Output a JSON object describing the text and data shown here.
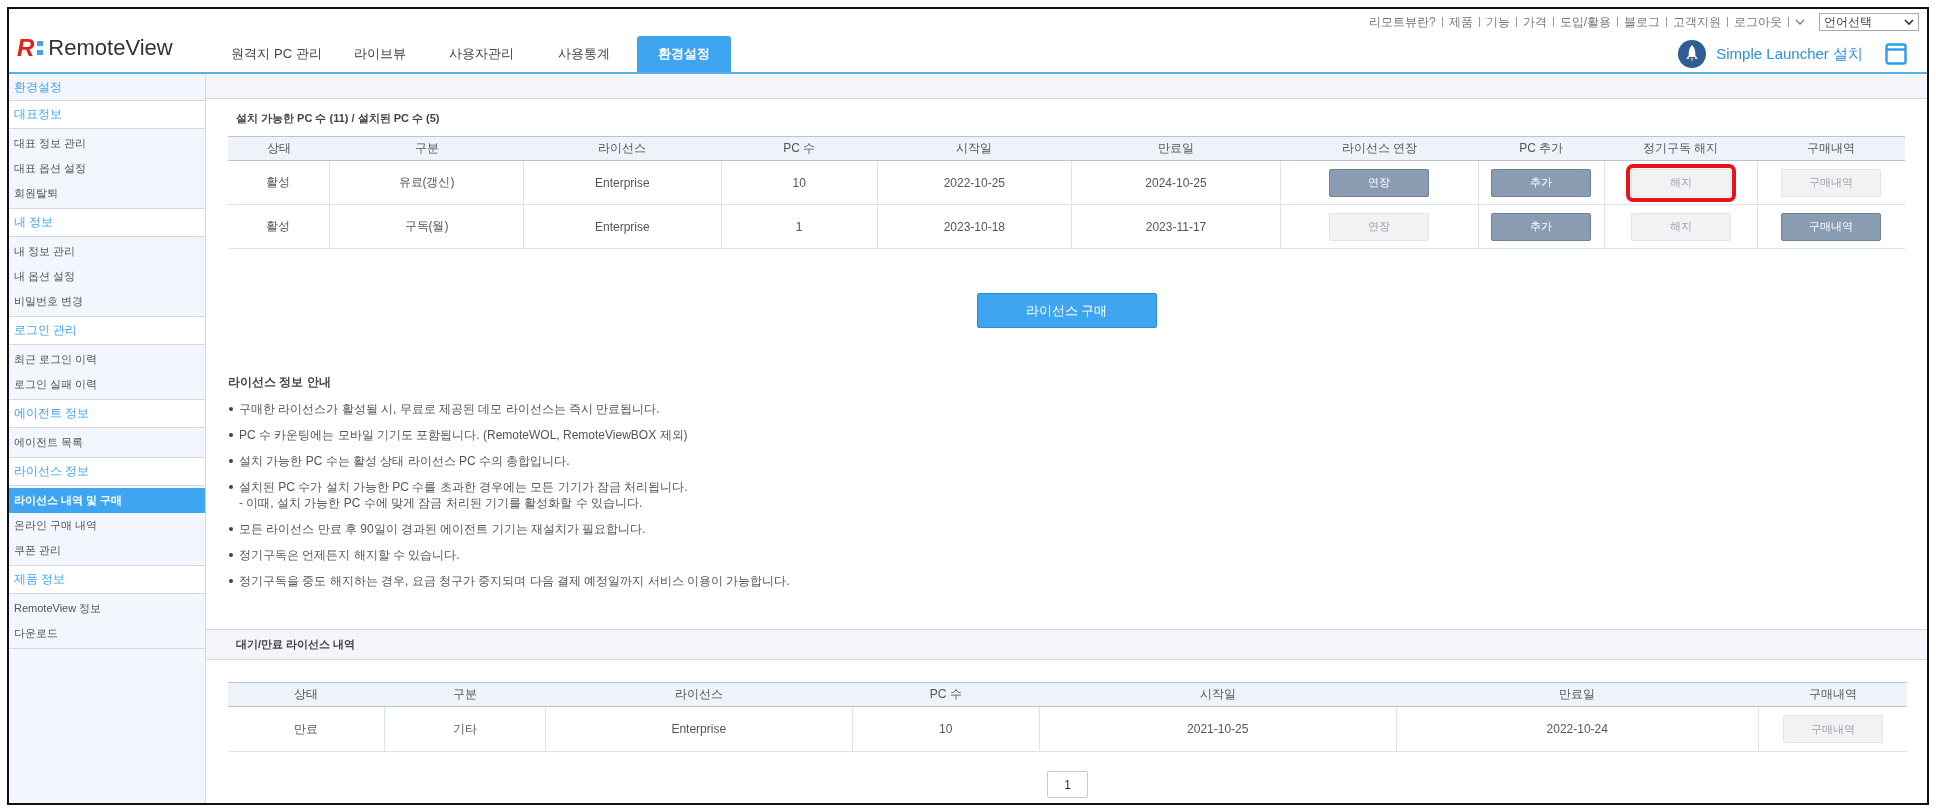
{
  "logo": {
    "letter": "R",
    "name": "RemoteView"
  },
  "tabs": [
    {
      "label": "원격지 PC 관리",
      "selected": false
    },
    {
      "label": "라이브뷰",
      "selected": false
    },
    {
      "label": "사용자관리",
      "selected": false
    },
    {
      "label": "사용통계",
      "selected": false
    },
    {
      "label": "환경설정",
      "selected": true
    }
  ],
  "top_links": [
    "리모트뷰란?",
    "제품",
    "기능",
    "가격",
    "도입/활용",
    "블로그",
    "고객지원",
    "로그아웃"
  ],
  "language_select": {
    "value": "언어선택"
  },
  "launcher_link": "Simple Launcher 설치",
  "sidebar": {
    "title": "환경설정",
    "sections": [
      {
        "title": "대표정보",
        "items": [
          {
            "label": "대표 정보 관리",
            "selected": false
          },
          {
            "label": "대표 옵션 설정",
            "selected": false
          },
          {
            "label": "회원탈퇴",
            "selected": false
          }
        ]
      },
      {
        "title": "내 정보",
        "items": [
          {
            "label": "내 정보 관리",
            "selected": false
          },
          {
            "label": "내 옵션 설정",
            "selected": false
          },
          {
            "label": "비밀번호 변경",
            "selected": false
          }
        ]
      },
      {
        "title": "로그인 관리",
        "items": [
          {
            "label": "최근 로그인 이력",
            "selected": false
          },
          {
            "label": "로그인 실패 이력",
            "selected": false
          }
        ]
      },
      {
        "title": "에이전트 정보",
        "items": [
          {
            "label": "에이전트 목록",
            "selected": false
          }
        ]
      },
      {
        "title": "라이선스 정보",
        "items": [
          {
            "label": "라이선스 내역 및 구매",
            "selected": true
          },
          {
            "label": "온라인 구매 내역",
            "selected": false
          },
          {
            "label": "쿠폰 관리",
            "selected": false
          }
        ]
      },
      {
        "title": "제품 정보",
        "items": [
          {
            "label": "RemoteView 정보",
            "selected": false
          },
          {
            "label": "다운로드",
            "selected": false
          }
        ]
      }
    ]
  },
  "license_table": {
    "title": "설치 가능한 PC 수 (11) / 설치된 PC 수 (5)",
    "columns": [
      "상태",
      "구분",
      "라이선스",
      "PC 수",
      "시작일",
      "만료일",
      "라이선스 연장",
      "PC 추가",
      "정기구독 해지",
      "구매내역"
    ],
    "rows": [
      {
        "cells": [
          {
            "kind": "text",
            "text": "활성"
          },
          {
            "kind": "text",
            "text": "유료(갱신)"
          },
          {
            "kind": "text",
            "text": "Enterprise"
          },
          {
            "kind": "text",
            "text": "10"
          },
          {
            "kind": "text",
            "text": "2022-10-25"
          },
          {
            "kind": "text",
            "text": "2024-10-25"
          },
          {
            "kind": "button",
            "label": "연장",
            "disabled": false,
            "highlighted": false
          },
          {
            "kind": "button",
            "label": "추가",
            "disabled": false,
            "highlighted": false
          },
          {
            "kind": "button",
            "label": "해지",
            "disabled": true,
            "highlighted": true
          },
          {
            "kind": "button",
            "label": "구매내역",
            "disabled": true,
            "highlighted": false
          }
        ]
      },
      {
        "cells": [
          {
            "kind": "text",
            "text": "활성"
          },
          {
            "kind": "text",
            "text": "구독(월)"
          },
          {
            "kind": "text",
            "text": "Enterprise"
          },
          {
            "kind": "text",
            "text": "1"
          },
          {
            "kind": "text",
            "text": "2023-10-18"
          },
          {
            "kind": "text",
            "text": "2023-11-17"
          },
          {
            "kind": "button",
            "label": "연장",
            "disabled": true,
            "highlighted": false
          },
          {
            "kind": "button",
            "label": "추가",
            "disabled": false,
            "highlighted": false
          },
          {
            "kind": "button",
            "label": "해지",
            "disabled": true,
            "highlighted": false
          },
          {
            "kind": "button",
            "label": "구매내역",
            "disabled": false,
            "highlighted": false
          }
        ]
      }
    ]
  },
  "purchase_button": "라이선스 구매",
  "notes": {
    "title": "라이선스 정보 안내",
    "items": [
      {
        "text": "구매한 라이선스가 활성될 시, 무료로 제공된 데모 라이선스는 즉시 만료됩니다."
      },
      {
        "text": "PC 수 카운팅에는 모바일 기기도 포함됩니다. (RemoteWOL, RemoteViewBOX 제외)"
      },
      {
        "text": "설치 가능한 PC 수는 활성 상태 라이선스 PC 수의 총합입니다."
      },
      {
        "text": "설치된 PC 수가 설치 가능한 PC 수를 초과한 경우에는 모든 기기가 잠금 처리됩니다.",
        "sub": "- 이때, 설치 가능한 PC 수에 맞게 잠금 처리된 기기를 활성화할 수 있습니다."
      },
      {
        "text": "모든 라이선스 만료 후 90일이 경과된 에이전트 기기는 재설치가 필요합니다."
      },
      {
        "text": "정기구독은 언제든지 해지할 수 있습니다."
      },
      {
        "text": "정기구독을 중도 해지하는 경우, 요금 청구가 중지되며 다음 결제 예정일까지 서비스 이용이 가능합니다."
      }
    ]
  },
  "expired_table": {
    "title": "대기/만료 라이선스 내역",
    "columns": [
      "상태",
      "구분",
      "라이선스",
      "PC 수",
      "시작일",
      "만료일",
      "구매내역"
    ],
    "rows": [
      {
        "cells": [
          {
            "kind": "text",
            "text": "만료"
          },
          {
            "kind": "text",
            "text": "기타"
          },
          {
            "kind": "text",
            "text": "Enterprise"
          },
          {
            "kind": "text",
            "text": "10"
          },
          {
            "kind": "text",
            "text": "2021-10-25"
          },
          {
            "kind": "text",
            "text": "2022-10-24"
          },
          {
            "kind": "button",
            "label": "구매내역",
            "disabled": true,
            "highlighted": false
          }
        ]
      }
    ]
  },
  "pagination": [
    "1"
  ]
}
